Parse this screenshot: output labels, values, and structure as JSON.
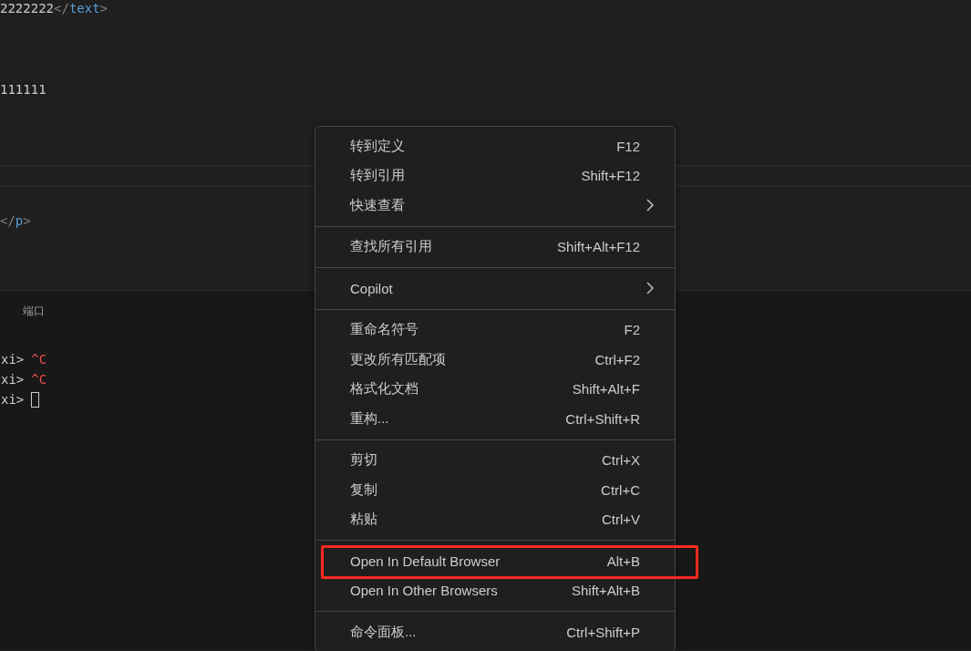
{
  "editor_top": {
    "lines": [
      {
        "segments": [
          {
            "kind": "plain",
            "text": "2222222"
          },
          {
            "kind": "punct",
            "text": "</"
          },
          {
            "kind": "tag",
            "text": "text"
          },
          {
            "kind": "punct",
            "text": ">"
          }
        ]
      },
      {
        "segments": [
          {
            "kind": "plain",
            "text": "111111"
          }
        ]
      }
    ]
  },
  "editor_bottom": {
    "lines": [
      {
        "segments": [
          {
            "kind": "punct",
            "text": "</"
          },
          {
            "kind": "tag",
            "text": "p"
          },
          {
            "kind": "punct",
            "text": ">"
          }
        ]
      }
    ]
  },
  "panel": {
    "tabs": [
      {
        "label": "端口",
        "selected": false
      }
    ],
    "terminal": [
      {
        "prompt": "xi>",
        "input": "^C",
        "cursor": false
      },
      {
        "prompt": "xi>",
        "input": "^C",
        "cursor": false
      },
      {
        "prompt": "xi>",
        "cursor": true
      }
    ]
  },
  "context_menu": {
    "groups": [
      [
        {
          "label": "转到定义",
          "shortcut": "F12",
          "submenu": false,
          "highlighted": false
        },
        {
          "label": "转到引用",
          "shortcut": "Shift+F12",
          "submenu": false,
          "highlighted": false
        },
        {
          "label": "快速查看",
          "submenu": true,
          "highlighted": false
        }
      ],
      [
        {
          "label": "查找所有引用",
          "shortcut": "Shift+Alt+F12",
          "submenu": false,
          "highlighted": false
        }
      ],
      [
        {
          "label": "Copilot",
          "submenu": true,
          "highlighted": false
        }
      ],
      [
        {
          "label": "重命名符号",
          "shortcut": "F2",
          "submenu": false,
          "highlighted": false
        },
        {
          "label": "更改所有匹配项",
          "shortcut": "Ctrl+F2",
          "submenu": false,
          "highlighted": false
        },
        {
          "label": "格式化文档",
          "shortcut": "Shift+Alt+F",
          "submenu": false,
          "highlighted": false
        },
        {
          "label": "重构...",
          "shortcut": "Ctrl+Shift+R",
          "submenu": false,
          "highlighted": false
        }
      ],
      [
        {
          "label": "剪切",
          "shortcut": "Ctrl+X",
          "submenu": false,
          "highlighted": false
        },
        {
          "label": "复制",
          "shortcut": "Ctrl+C",
          "submenu": false,
          "highlighted": false
        },
        {
          "label": "粘贴",
          "shortcut": "Ctrl+V",
          "submenu": false,
          "highlighted": false
        }
      ],
      [
        {
          "label": "Open In Default Browser",
          "shortcut": "Alt+B",
          "submenu": false,
          "highlighted": true
        },
        {
          "label": "Open In Other Browsers",
          "shortcut": "Shift+Alt+B",
          "submenu": false,
          "highlighted": false
        }
      ],
      [
        {
          "label": "命令面板...",
          "shortcut": "Ctrl+Shift+P",
          "submenu": false,
          "highlighted": false
        }
      ]
    ]
  }
}
